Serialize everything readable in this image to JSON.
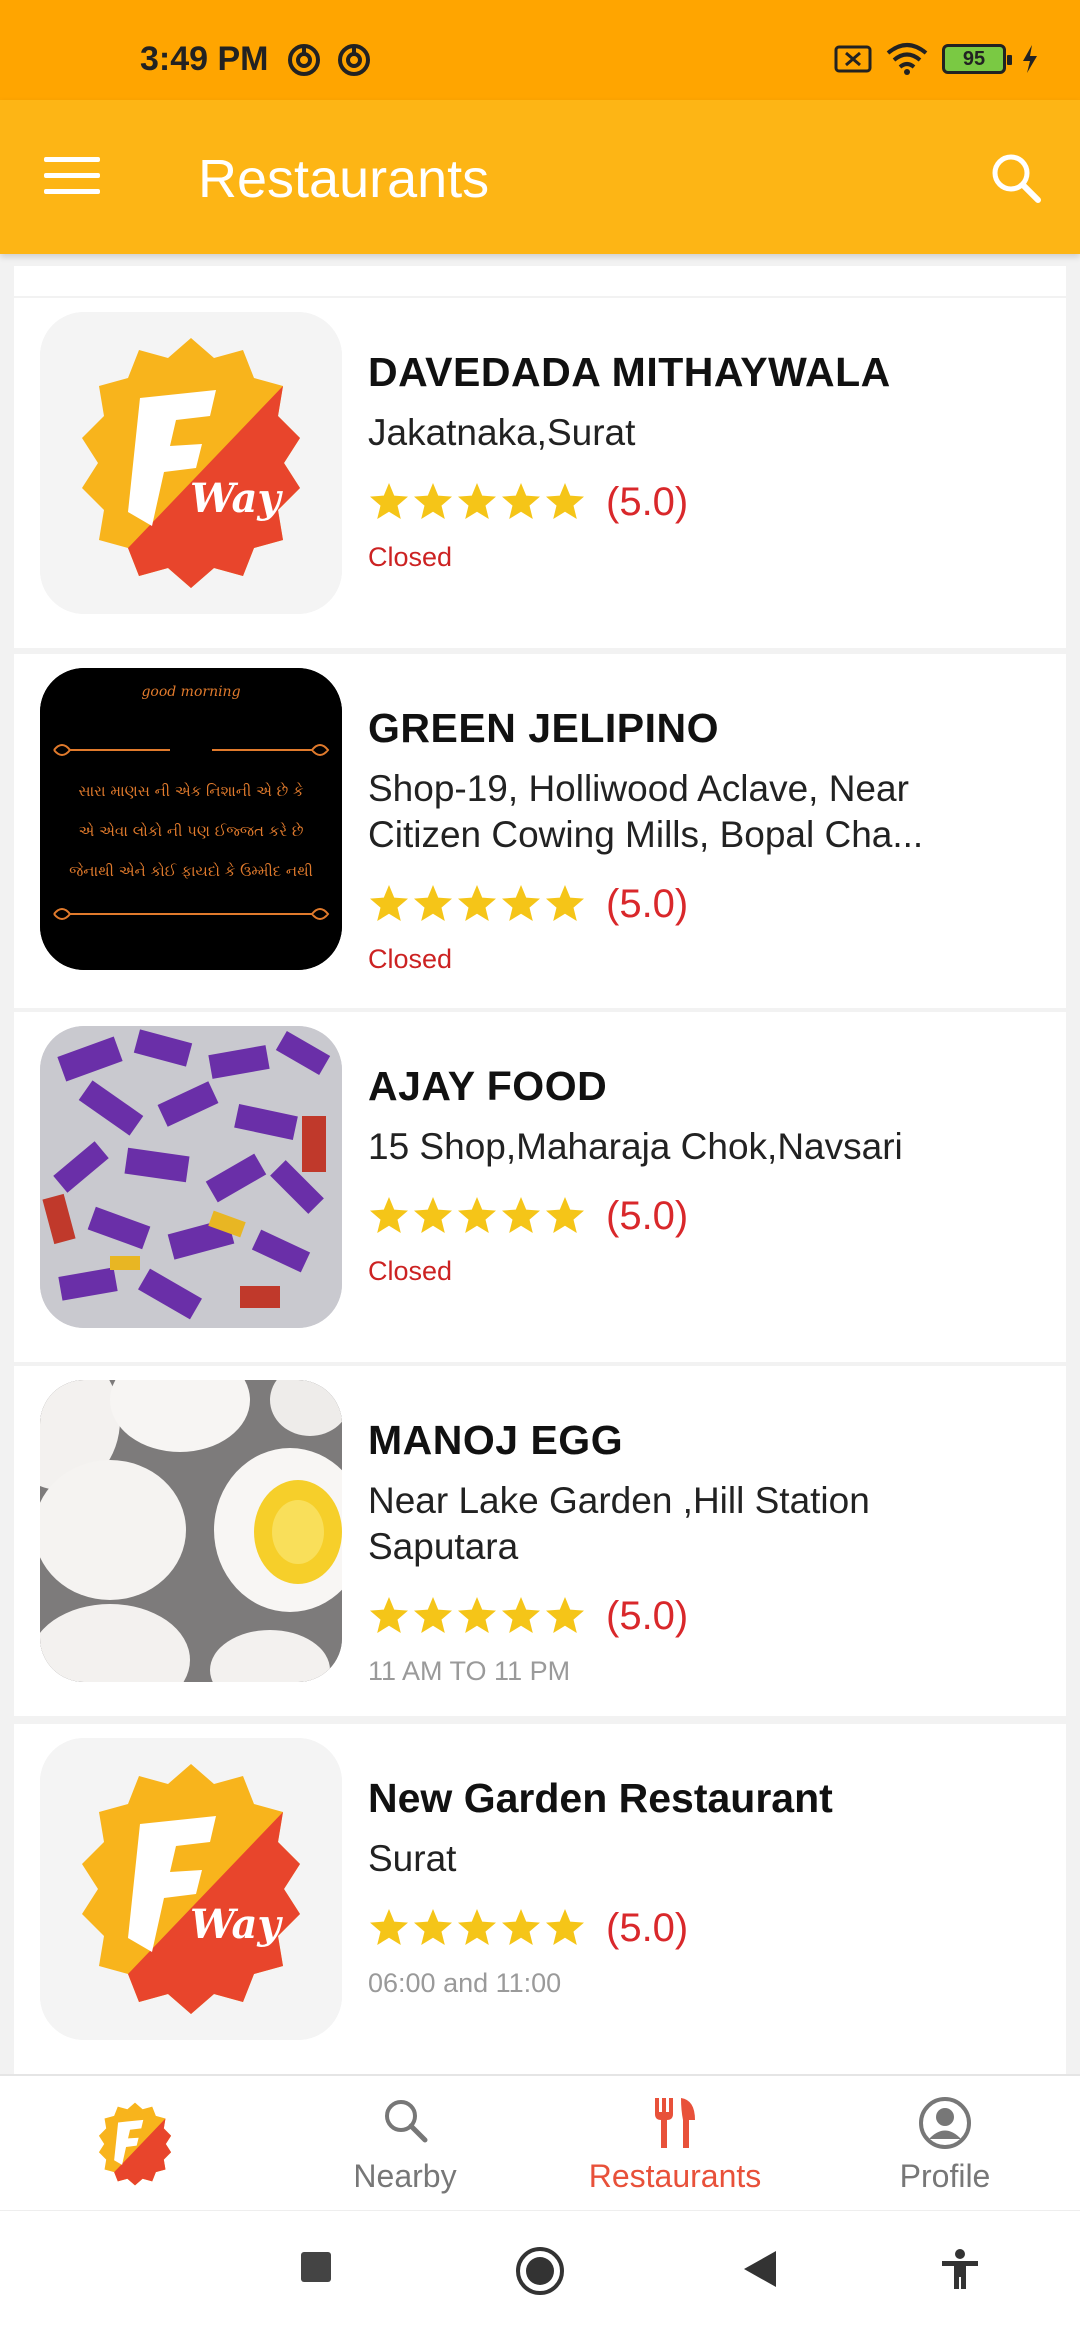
{
  "status_bar": {
    "time": "3:49 PM",
    "battery": "95",
    "icons": [
      "vpn-icon",
      "vpn-icon",
      "sim-off-icon",
      "wifi-icon",
      "battery-icon",
      "charging-icon"
    ]
  },
  "app_bar": {
    "title": "Restaurants",
    "menu_icon": "hamburger-menu-icon",
    "search_icon": "search-icon"
  },
  "restaurants": [
    {
      "name": "DAVEDADA MITHAYWALA",
      "address": "Jakatnaka,Surat",
      "rating": "(5.0)",
      "stars": 5,
      "status": "Closed",
      "status_type": "closed",
      "image": "fway-logo"
    },
    {
      "name": "GREEN JELIPINO",
      "address": "Shop-19, Holliwood Aclave, Near Citizen Cowing Mills, Bopal Cha...",
      "rating": "(5.0)",
      "stars": 5,
      "status": "Closed",
      "status_type": "closed",
      "image": "good-morning-quote",
      "image_text": {
        "header": "good morning",
        "line1": "સારા માણસ ની એક નિશાની એ છે કે",
        "line2": "એ એવા લોકો ની પણ ઈજ્જત કરે છે",
        "line3": "જેનાથી એને કોઈ ફાયદો કે ઉમ્મીદ નથી"
      }
    },
    {
      "name": "AJAY FOOD",
      "address": "15 Shop,Maharaja Chok,Navsari",
      "rating": "(5.0)",
      "stars": 5,
      "status": "Closed",
      "status_type": "closed",
      "image": "chocolate-wrappers-photo"
    },
    {
      "name": "MANOJ EGG",
      "address": "Near Lake Garden ,Hill Station Saputara",
      "rating": "(5.0)",
      "stars": 5,
      "status": "11 AM TO 11 PM",
      "status_type": "hours",
      "image": "eggs-photo"
    },
    {
      "name": "New Garden Restaurant",
      "address": "Surat",
      "rating": "(5.0)",
      "stars": 5,
      "status": "06:00 and 11:00",
      "status_type": "hours",
      "image": "fway-logo"
    }
  ],
  "logo_text": "Way",
  "bottom_nav": [
    {
      "id": "home",
      "label": "",
      "icon": "fway-logo-icon",
      "active": false
    },
    {
      "id": "nearby",
      "label": "Nearby",
      "icon": "search-icon",
      "active": false
    },
    {
      "id": "restaurants",
      "label": "Restaurants",
      "icon": "fork-knife-icon",
      "active": true
    },
    {
      "id": "profile",
      "label": "Profile",
      "icon": "profile-icon",
      "active": false
    }
  ],
  "colors": {
    "status_bar": "#FFA500",
    "app_bar": "#FDB515",
    "star": "#F5C518",
    "rating_text": "#D9282B",
    "closed": "#CC2222",
    "hours": "#9A9A9A",
    "active_nav": "#E8513A"
  }
}
